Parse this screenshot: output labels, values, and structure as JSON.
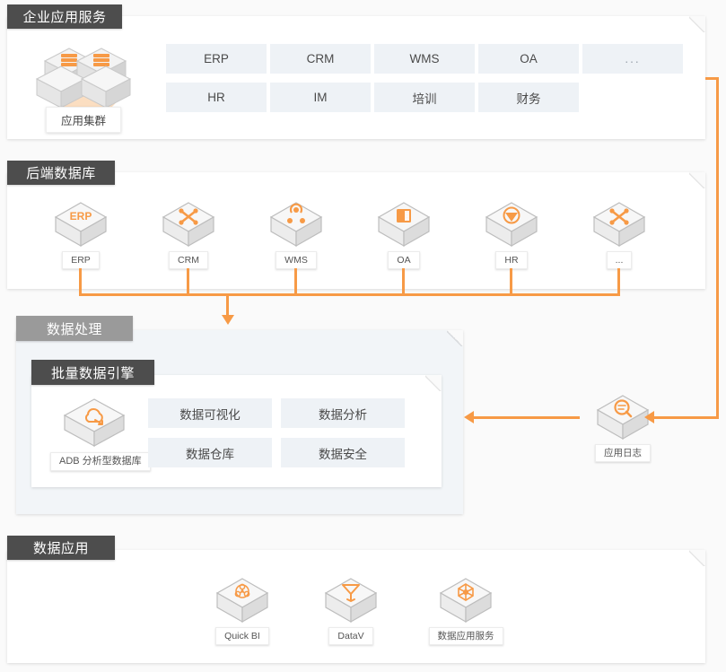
{
  "theme": {
    "accent": "#f79a46",
    "tab_dark": "#4d4d4d",
    "tab_gray": "#9a9a9a",
    "tile_bg": "#eef2f6",
    "panel_bg": "#ffffff",
    "panel_tint": "#f2f5f8",
    "page_bg": "#fafafa"
  },
  "sections": {
    "apps": {
      "title": "企业应用服务",
      "cluster": {
        "label": "应用集群",
        "icon": "server-cluster-icon"
      },
      "tiles": [
        {
          "label": "ERP"
        },
        {
          "label": "CRM"
        },
        {
          "label": "WMS"
        },
        {
          "label": "OA"
        },
        {
          "label": "..."
        },
        {
          "label": "HR"
        },
        {
          "label": "IM"
        },
        {
          "label": "培训"
        },
        {
          "label": "财务"
        }
      ]
    },
    "databases": {
      "title": "后端数据库",
      "nodes": [
        {
          "label": "ERP",
          "icon": "erp-cube-icon"
        },
        {
          "label": "CRM",
          "icon": "crm-cube-icon"
        },
        {
          "label": "WMS",
          "icon": "wms-cube-icon"
        },
        {
          "label": "OA",
          "icon": "oa-cube-icon"
        },
        {
          "label": "HR",
          "icon": "hr-cube-icon"
        },
        {
          "label": "...",
          "icon": "more-cube-icon"
        }
      ]
    },
    "processing": {
      "title": "数据处理",
      "engine": {
        "title": "批量数据引擎",
        "node": {
          "label": "ADB 分析型数据库",
          "icon": "adb-cloud-cube-icon"
        },
        "tiles": [
          {
            "label": "数据可视化"
          },
          {
            "label": "数据分析"
          },
          {
            "label": "数据仓库"
          },
          {
            "label": "数据安全"
          }
        ]
      }
    },
    "log": {
      "node": {
        "label": "应用日志",
        "icon": "log-search-cube-icon"
      }
    },
    "applications": {
      "title": "数据应用",
      "nodes": [
        {
          "label": "Quick BI",
          "icon": "quickbi-cube-icon"
        },
        {
          "label": "DataV",
          "icon": "datav-cube-icon"
        },
        {
          "label": "数据应用服务",
          "icon": "data-app-service-cube-icon"
        }
      ]
    }
  }
}
